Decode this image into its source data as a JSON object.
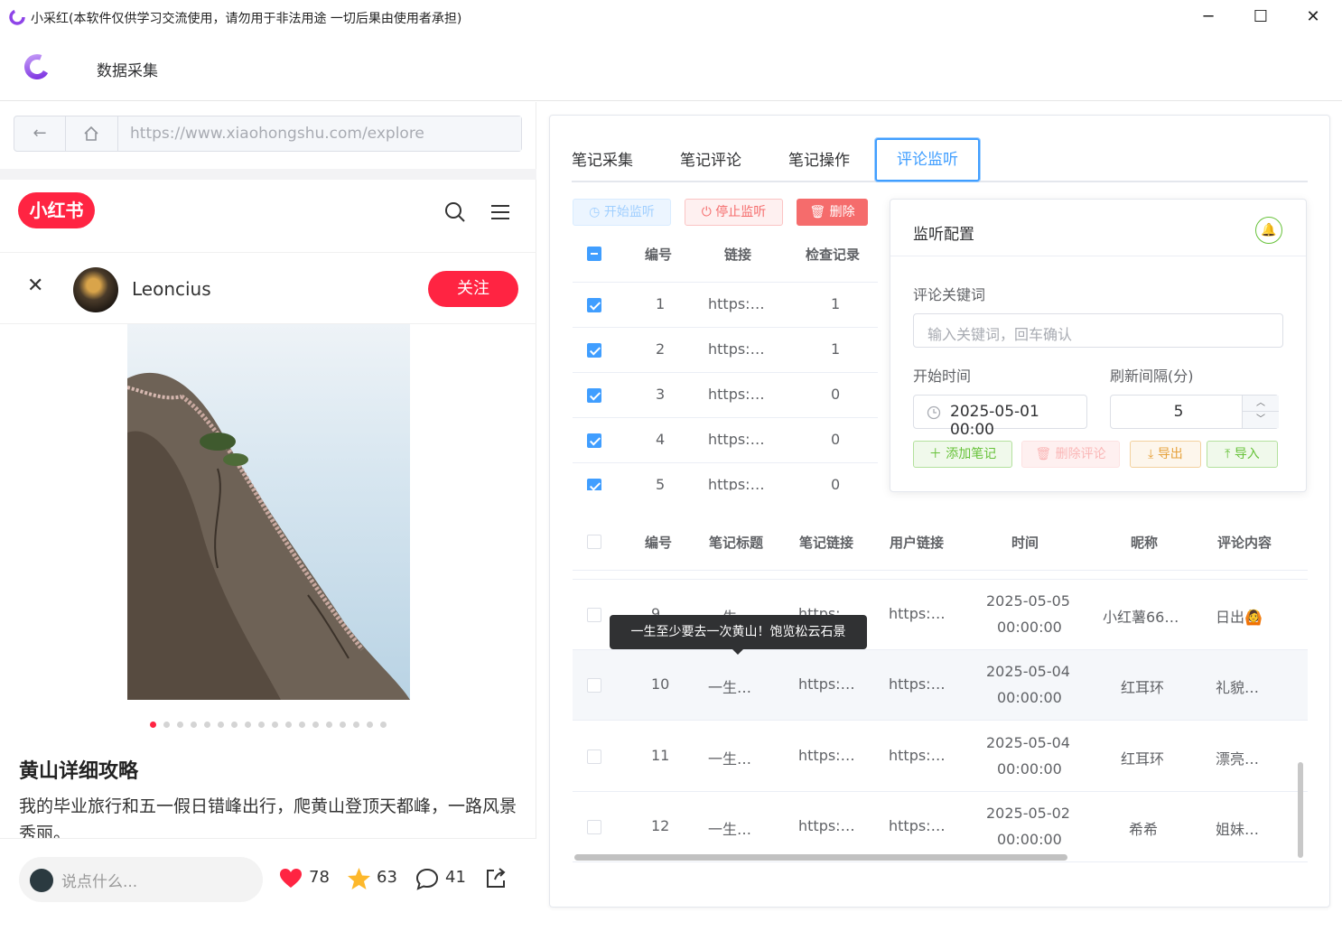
{
  "window": {
    "title": "小采红(本软件仅供学习交流使用，请勿用于非法用途 一切后果由使用者承担)",
    "minimize": "─",
    "maximize": "☐",
    "close": "✕"
  },
  "app": {
    "nav_label": "数据采集"
  },
  "browser": {
    "url": "https://www.xiaohongshu.com/explore",
    "back": "←",
    "home": "⌂"
  },
  "xhs": {
    "logo": "小红书",
    "author_name": "Leoncius",
    "follow_label": "关注",
    "close": "✕",
    "note_title": "黄山详细攻略",
    "note_desc": "我的毕业旅行和五一假日错峰出行，爬黄山登顶天都峰，一路风景秀丽。",
    "comment_placeholder": "说点什么...",
    "likes": "78",
    "stars": "63",
    "comments": "41",
    "image_count": 18,
    "image_index": 1
  },
  "tabs": [
    {
      "label": "笔记采集"
    },
    {
      "label": "笔记评论"
    },
    {
      "label": "笔记操作"
    },
    {
      "label": "评论监听"
    }
  ],
  "monitor": {
    "start_label": "开始监听",
    "stop_label": "停止监听",
    "delete_label": "删除",
    "headers": [
      "编号",
      "链接",
      "检查记录"
    ],
    "rows": [
      {
        "id": "1",
        "link": "https:…",
        "record": "1"
      },
      {
        "id": "2",
        "link": "https:…",
        "record": "1"
      },
      {
        "id": "3",
        "link": "https:…",
        "record": "0"
      },
      {
        "id": "4",
        "link": "https:…",
        "record": "0"
      },
      {
        "id": "5",
        "link": "https:…",
        "record": "0"
      }
    ]
  },
  "config": {
    "title": "监听配置",
    "keyword_label": "评论关键词",
    "keyword_placeholder": "输入关键词，回车确认",
    "start_time_label": "开始时间",
    "start_time_value": "2025-05-01 00:00",
    "interval_label": "刷新间隔(分)",
    "interval_value": "5",
    "add_note": "添加笔记",
    "delete_comment": "删除评论",
    "export": "导出",
    "import": "导入"
  },
  "comments": {
    "headers": [
      "编号",
      "笔记标题",
      "笔记链接",
      "用户链接",
      "时间",
      "昵称",
      "评论内容"
    ],
    "rows": [
      {
        "id": "9",
        "title": "一生…",
        "note_link": "https:…",
        "user_link": "https:…",
        "date": "2025-05-05",
        "time": "00:00:00",
        "nick": "小红薯66…",
        "content": "日出🙆"
      },
      {
        "id": "10",
        "title": "一生…",
        "note_link": "https:…",
        "user_link": "https:…",
        "date": "2025-05-04",
        "time": "00:00:00",
        "nick": "红耳环",
        "content": "礼貌…"
      },
      {
        "id": "11",
        "title": "一生…",
        "note_link": "https:…",
        "user_link": "https:…",
        "date": "2025-05-04",
        "time": "00:00:00",
        "nick": "红耳环",
        "content": "漂亮…"
      },
      {
        "id": "12",
        "title": "一生…",
        "note_link": "https:…",
        "user_link": "https:…",
        "date": "2025-05-02",
        "time": "00:00:00",
        "nick": "希希",
        "content": "姐妹…"
      }
    ],
    "tooltip": "一生至少要去一次黄山！饱览松云石景"
  },
  "colors": {
    "brand_red": "#ff2442",
    "accent_blue": "#409eff",
    "danger": "#f56c6c",
    "success": "#67c23a",
    "warning": "#e6a23c"
  }
}
